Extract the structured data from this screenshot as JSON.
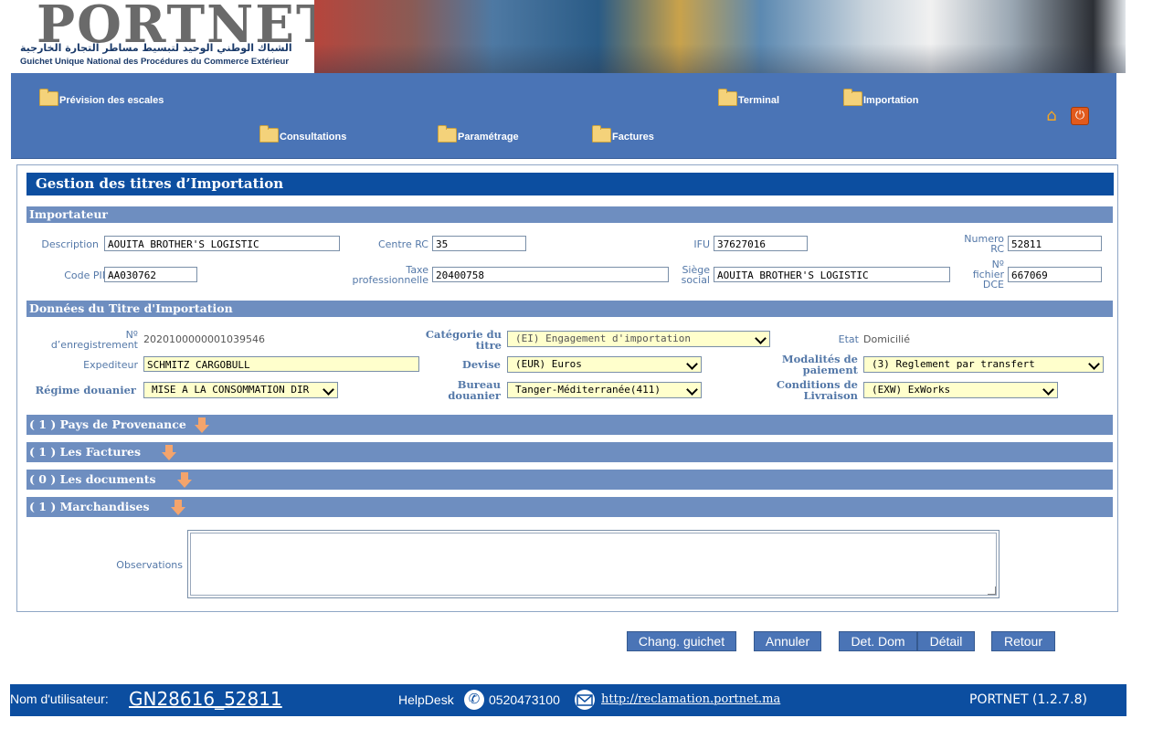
{
  "header": {
    "logo": "PORTNET",
    "tagline_ar": "الشباك الوطني الوحيد لتبسيط مساطر التجارة الخارجية",
    "tagline_fr": "Guichet Unique National des Procédures du Commerce Extérieur"
  },
  "nav": {
    "items": [
      {
        "label": "Prévision des escales",
        "icon": "folder-icon"
      },
      {
        "label": "Terminal",
        "icon": "folder-icon"
      },
      {
        "label": "Importation",
        "icon": "folder-icon"
      },
      {
        "label": "Consultations",
        "icon": "folder-icon"
      },
      {
        "label": "Paramétrage",
        "icon": "folder-icon"
      },
      {
        "label": "Factures",
        "icon": "folder-icon"
      }
    ],
    "home_icon": "home-icon",
    "logout_icon": "power-icon"
  },
  "page": {
    "title": "Gestion des titres d’Importation"
  },
  "importateur": {
    "section": "Importateur",
    "description_label": "Description",
    "description": "AOUITA BROTHER'S LOGISTIC",
    "centre_rc_label": "Centre RC",
    "centre_rc": "35",
    "ifu_label": "IFU",
    "ifu": "37627016",
    "numero_rc_label_1": "Numero",
    "numero_rc_label_2": "RC",
    "numero_rc": "52811",
    "code_pin_label": "Code PIN",
    "code_pin": "AA030762",
    "taxe_label_1": "Taxe",
    "taxe_label_2": "professionnelle",
    "taxe": "20400758",
    "siege_label_1": "Siège",
    "siege_label_2": "social",
    "siege": "AOUITA BROTHER'S LOGISTIC",
    "fichier_label_1": "Nº",
    "fichier_label_2": "fichier",
    "fichier_label_3": "DCE",
    "fichier": "667069"
  },
  "titre": {
    "section": "Données du Titre d'Importation",
    "enreg_label_1": "Nº",
    "enreg_label_2": "d’enregistrement",
    "enreg": "2020100000001039546",
    "categorie_label_1": "Catégorie du",
    "categorie_label_2": "titre",
    "categorie": "(EI) Engagement d'importation",
    "etat_label": "Etat",
    "etat": "Domicilié",
    "expediteur_label": "Expediteur",
    "expediteur": "SCHMITZ CARGOBULL",
    "devise_label": "Devise",
    "devise": "(EUR) Euros",
    "modalites_label_1": "Modalités de",
    "modalites_label_2": "paiement",
    "modalites": "(3) Reglement par transfert",
    "regime_label": "Régime douanier",
    "regime": "MISE A LA CONSOMMATION DIR",
    "bureau_label_1": "Bureau",
    "bureau_label_2": "douanier",
    "bureau": "Tanger-Méditerranée(411)",
    "conditions_label_1": "Conditions de",
    "conditions_label_2": "Livraison",
    "conditions": "(EXW) ExWorks"
  },
  "accordions": [
    {
      "label": "( 1 ) Pays de Provenance"
    },
    {
      "label": "( 1 ) Les Factures"
    },
    {
      "label": "( 0 ) Les documents"
    },
    {
      "label": "( 1 ) Marchandises"
    }
  ],
  "observations": {
    "label": "Observations",
    "value": ""
  },
  "buttons": {
    "chang_guichet": "Chang. guichet",
    "annuler": "Annuler",
    "det_dom": "Det. Dom",
    "detail": "Détail",
    "retour": "Retour"
  },
  "footer": {
    "user_label": "Nom d'utilisateur:",
    "username": "GN28616_52811",
    "helpdesk": "HelpDesk",
    "phone": "0520473100",
    "link": "http://reclamation.portnet.ma",
    "version": "PORTNET (1.2.7.8)"
  },
  "colors": {
    "nav_bg": "#4a74b6",
    "title_bg": "#0c4ea0",
    "section_bg": "#6e8ec0",
    "select_bg": "#ffffcc"
  }
}
